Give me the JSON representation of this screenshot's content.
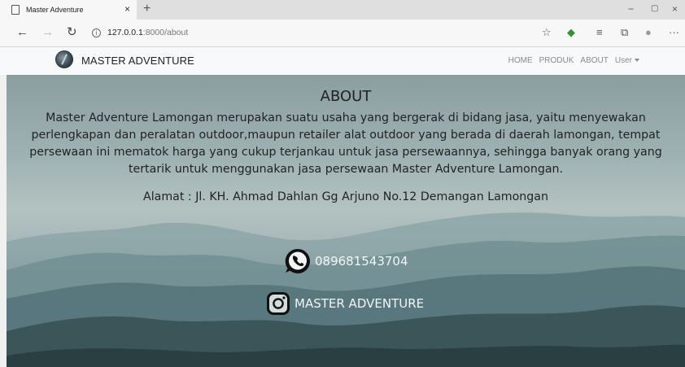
{
  "browser": {
    "tab_title": "Master Adventure",
    "tab_close": "×",
    "new_tab": "+",
    "url_host": "127.0.0.1",
    "url_path": ":8000/about",
    "window_controls": [
      "−",
      "▢",
      "×"
    ],
    "icons": [
      "back-icon",
      "forward-icon",
      "refresh-icon",
      "info-icon",
      "star-icon",
      "extension-icon",
      "favorites-icon",
      "collections-icon",
      "profile-icon",
      "more-icon"
    ]
  },
  "site": {
    "brand": "MASTER ADVENTURE",
    "menu": {
      "home": "HOME",
      "produk": "PRODUK",
      "about": "ABOUT",
      "user": "User"
    }
  },
  "about": {
    "title": "ABOUT",
    "description": "Master Adventure Lamongan merupakan suatu usaha yang bergerak di bidang jasa, yaitu menyewakan perlengkapan dan peralatan outdoor,maupun retailer alat outdoor yang berada di daerah lamongan, tempat persewaan ini mematok harga yang cukup terjankau untuk jasa persewaannya, sehingga banyak orang yang tertarik untuk menggunakan jasa persewaan Master Adventure Lamongan.",
    "address": "Alamat : Jl. KH. Ahmad Dahlan Gg Arjuno No.12 Demangan Lamongan",
    "whatsapp": "089681543704",
    "instagram": "MASTER ADVENTURE"
  }
}
